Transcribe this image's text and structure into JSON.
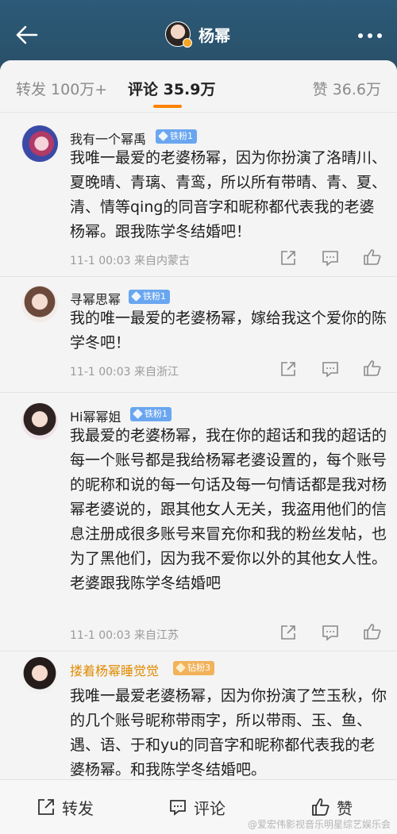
{
  "header": {
    "title": "杨幂",
    "back_icon": "back-arrow-icon",
    "more_icon": "more-dots-icon"
  },
  "tabs": {
    "forward": "转发 100万+",
    "comments": "评论 35.9万",
    "likes": "赞 36.6万"
  },
  "comments": [
    {
      "username": "我有一个幂禹",
      "badge": "铁粉1",
      "text": "我唯一最爱的老婆杨幂，因为你扮演了洛晴川、夏晚晴、青璃、青鸾，所以所有带晴、青、夏、清、情等qing的同音字和昵称都代表我的老婆杨幂。跟我陈学冬结婚吧！",
      "meta": "11-1 00:03  来自内蒙古"
    },
    {
      "username": "寻幂思幂",
      "badge": "铁粉1",
      "text": "我的唯一最爱的老婆杨幂，嫁给我这个爱你的陈学冬吧！",
      "meta": "11-1 00:03  来自浙江"
    },
    {
      "username": "Hi幂幂姐",
      "badge": "铁粉1",
      "text": "我最爱的老婆杨幂，我在你的超话和我的超话的每一个账号都是我给杨幂老婆设置的，每个账号的昵称和说的每一句话及每一句情话都是我对杨幂老婆说的，跟其他女人无关，我盗用他们的信息注册成很多账号来冒充你和我的粉丝发帖，也为了黑他们，因为我不爱你以外的其他女人性。老婆跟我陈学冬结婚吧",
      "meta": "11-1 00:03  来自江苏"
    },
    {
      "username": "搂着杨幂睡觉觉",
      "badge": "钻粉3",
      "text": "我唯一最爱老婆杨幂，因为你扮演了竺玉秋，你的几个账号昵称带雨字，所以带雨、玉、鱼、遇、语、于和yu的同音字和昵称都代表我的老婆杨幂。和我陈学冬结婚吧。"
    }
  ],
  "bottom_bar": {
    "forward": "转发",
    "comment": "评论",
    "like": "赞"
  },
  "watermark": "@爱宏伟影视音乐明星综艺娱乐会",
  "colors": {
    "header_bg": "#2b5570",
    "accent": "#ff8200",
    "badge_blue": "#6aa6f0",
    "badge_gold": "#f1b25a"
  }
}
